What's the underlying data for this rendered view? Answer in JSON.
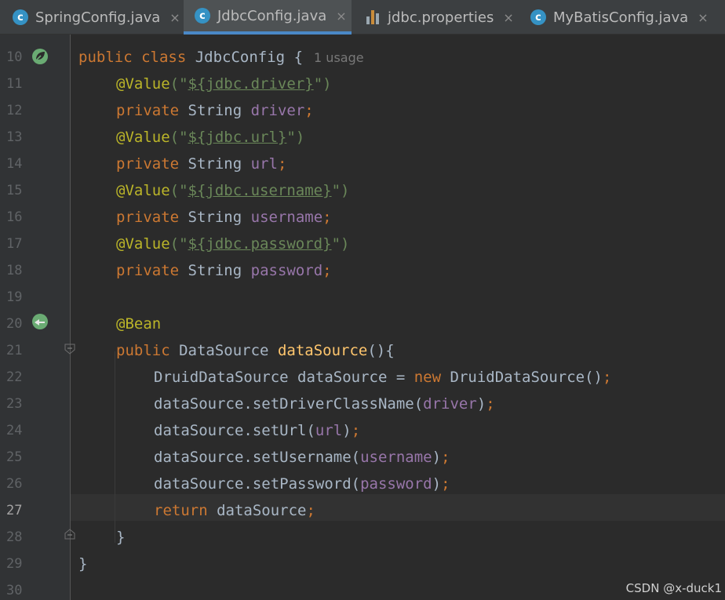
{
  "tabs": [
    {
      "label": "SpringConfig.java",
      "icon": "java-class-icon",
      "active": false
    },
    {
      "label": "JdbcConfig.java",
      "icon": "java-class-icon",
      "active": true
    },
    {
      "label": "jdbc.properties",
      "icon": "properties-file-icon",
      "active": false
    },
    {
      "label": "MyBatisConfig.java",
      "icon": "java-class-icon",
      "active": false
    }
  ],
  "tab_close_glyph": "×",
  "class_icon_glyph": "c",
  "line_numbers": [
    "10",
    "11",
    "12",
    "13",
    "14",
    "15",
    "16",
    "17",
    "18",
    "19",
    "20",
    "21",
    "22",
    "23",
    "24",
    "25",
    "26",
    "27",
    "28",
    "29",
    "30"
  ],
  "current_line": "27",
  "code": {
    "l10": {
      "kw": "public class",
      "name": "JdbcConfig",
      "brace": "{",
      "hint": "1 usage"
    },
    "l11": {
      "ann": "@Value",
      "open": "(\"",
      "ph": "${jdbc.driver}",
      "close": "\")"
    },
    "l12": {
      "kw": "private",
      "type": "String",
      "field": "driver",
      "semi": ";"
    },
    "l13": {
      "ann": "@Value",
      "open": "(\"",
      "ph": "${jdbc.url}",
      "close": "\")"
    },
    "l14": {
      "kw": "private",
      "type": "String",
      "field": "url",
      "semi": ";"
    },
    "l15": {
      "ann": "@Value",
      "open": "(\"",
      "ph": "${jdbc.username}",
      "close": "\")"
    },
    "l16": {
      "kw": "private",
      "type": "String",
      "field": "username",
      "semi": ";"
    },
    "l17": {
      "ann": "@Value",
      "open": "(\"",
      "ph": "${jdbc.password}",
      "close": "\")"
    },
    "l18": {
      "kw": "private",
      "type": "String",
      "field": "password",
      "semi": ";"
    },
    "l20": {
      "ann": "@Bean"
    },
    "l21": {
      "kw": "public",
      "type": "DataSource",
      "method": "dataSource",
      "rest": "(){"
    },
    "l22": {
      "a": "DruidDataSource dataSource = ",
      "kw": "new",
      "b": " DruidDataSource()",
      "semi": ";"
    },
    "l23": {
      "a": "dataSource.setDriverClassName(",
      "field": "driver",
      "b": ")",
      "semi": ";"
    },
    "l24": {
      "a": "dataSource.setUrl(",
      "field": "url",
      "b": ")",
      "semi": ";"
    },
    "l25": {
      "a": "dataSource.setUsername(",
      "field": "username",
      "b": ")",
      "semi": ";"
    },
    "l26": {
      "a": "dataSource.setPassword(",
      "field": "password",
      "b": ")",
      "semi": ";"
    },
    "l27": {
      "kw": "return",
      "a": " dataSource",
      "semi": ";"
    },
    "l28": {
      "text": "}"
    },
    "l29": {
      "text": "}"
    }
  },
  "watermark": "CSDN @x-duck1",
  "colors": {
    "keyword": "#cc7832",
    "annotation": "#bbb529",
    "string": "#6a8759",
    "field": "#9876aa",
    "method": "#ffc66d",
    "text": "#a9b7c6"
  }
}
